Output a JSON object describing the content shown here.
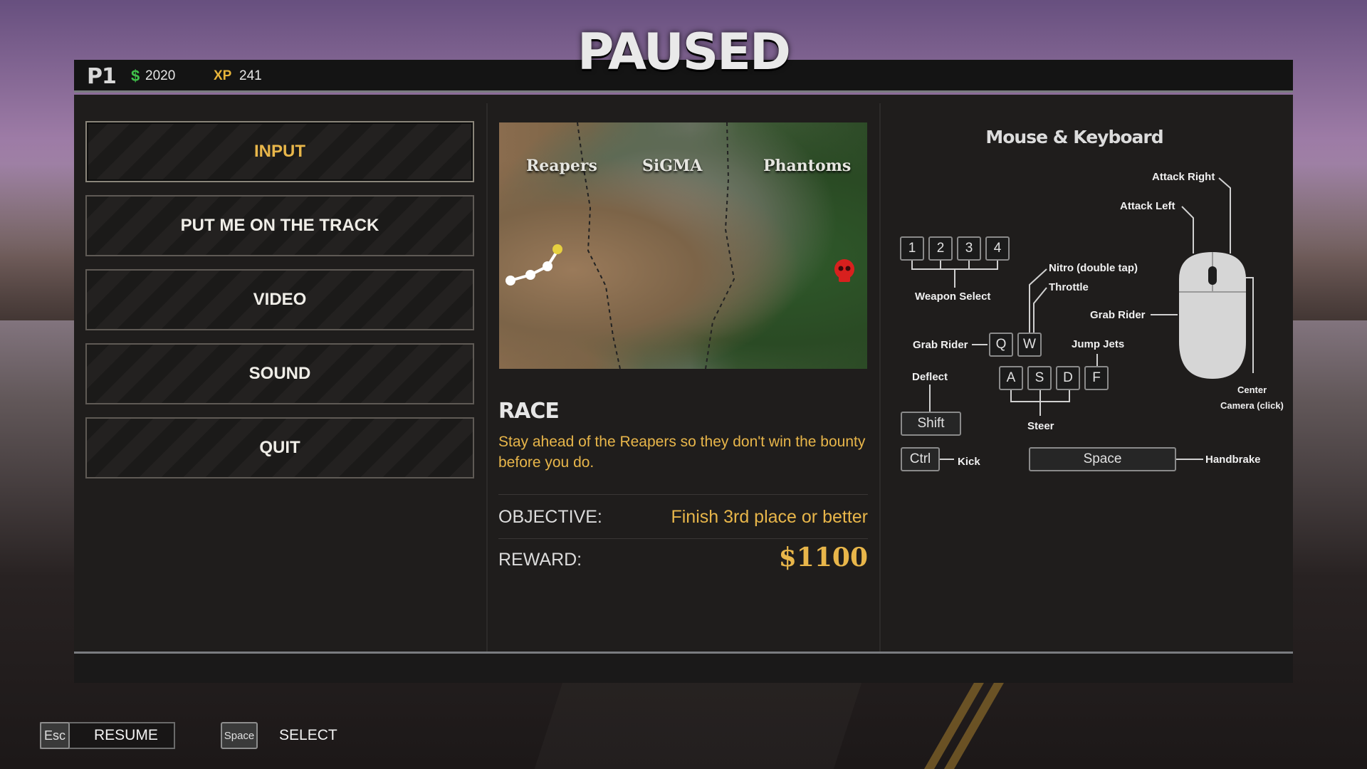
{
  "header": {
    "title": "PAUSED",
    "player": "P1",
    "money_symbol": "$",
    "money": "2020",
    "xp_label": "XP",
    "xp": "241"
  },
  "menu": {
    "items": [
      {
        "label": "INPUT",
        "active": true
      },
      {
        "label": "PUT ME ON THE TRACK",
        "active": false
      },
      {
        "label": "VIDEO",
        "active": false
      },
      {
        "label": "SOUND",
        "active": false
      },
      {
        "label": "QUIT",
        "active": false
      }
    ]
  },
  "map": {
    "regions": [
      "Reapers",
      "SiGMA",
      "Phantoms"
    ],
    "skull_color": "#d8201e",
    "route_color": "#ffffff",
    "current_point_color": "#e6d040"
  },
  "event": {
    "type": "RACE",
    "description": "Stay ahead of the Reapers so they don't win the bounty before you do.",
    "objective_label": "OBJECTIVE:",
    "objective_value": "Finish 3rd place or better",
    "reward_label": "REWARD:",
    "reward_value": "$1100"
  },
  "controls": {
    "title": "Mouse & Keyboard",
    "keys": {
      "k1": "1",
      "k2": "2",
      "k3": "3",
      "k4": "4",
      "q": "Q",
      "w": "W",
      "a": "A",
      "s": "S",
      "d": "D",
      "f": "F",
      "shift": "Shift",
      "ctrl": "Ctrl",
      "space": "Space"
    },
    "labels": {
      "weapon_select": "Weapon Select",
      "nitro": "Nitro (double tap)",
      "throttle": "Throttle",
      "grab_rider_left": "Grab Rider",
      "grab_rider_mouse": "Grab Rider",
      "jump_jets": "Jump Jets",
      "deflect": "Deflect",
      "steer": "Steer",
      "kick": "Kick",
      "handbrake": "Handbrake",
      "attack_right": "Attack Right",
      "attack_left": "Attack Left",
      "center": "Center",
      "camera_click": "Camera (click)"
    }
  },
  "footer": {
    "resume_key": "Esc",
    "resume_label": "RESUME",
    "select_key": "Space",
    "select_label": "SELECT"
  },
  "colors": {
    "accent": "#e8b64a",
    "money": "#3fc14a",
    "xp": "#e7b43a"
  }
}
